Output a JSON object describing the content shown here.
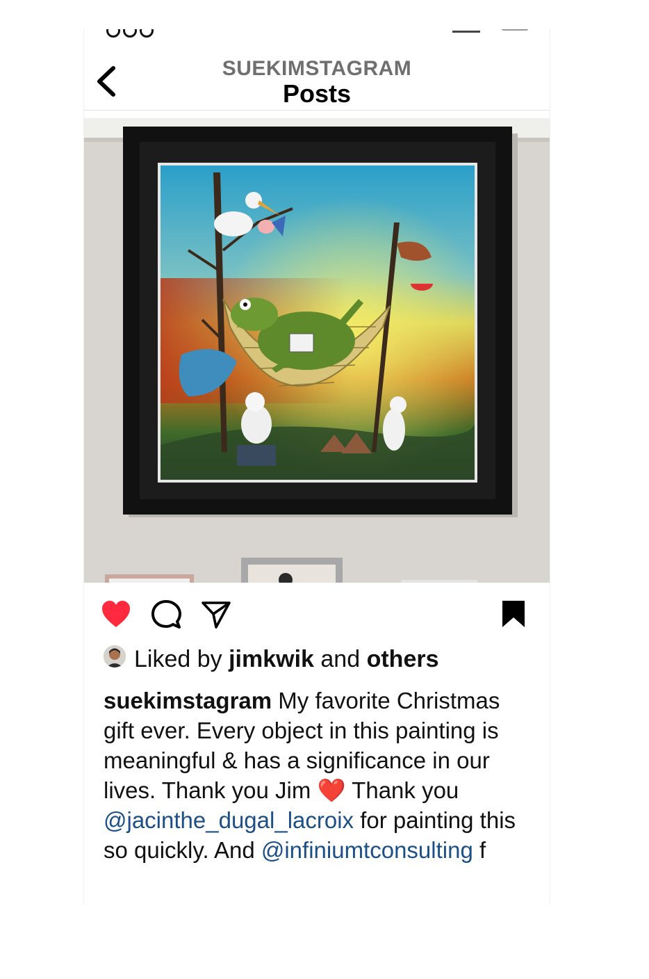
{
  "header": {
    "username": "SUEKIMSTAGRAM",
    "title": "Posts"
  },
  "post": {
    "image_alt": "Framed painting of a frog in a hammock with animals",
    "liked": true,
    "saved": true,
    "likes": {
      "prefix": "Liked by",
      "first_user": "jimkwik",
      "joiner": "and",
      "others": "others"
    },
    "caption": {
      "username": "suekimstagram",
      "text_1": " My favorite Christmas gift ever. Every object in this painting is meaningful & has a significance in our lives. Thank you Jim ",
      "emoji": "❤️",
      "text_2": " Thank you ",
      "mention_1": "@jacinthe_dugal_lacroix",
      "text_3": " for painting this so quickly. And ",
      "mention_2": "@infiniumtconsulting",
      "text_4": " f"
    }
  },
  "colors": {
    "like_red": "#ff2a3d",
    "mention_blue": "#1d4f86",
    "username_gray": "#6f6f6f"
  }
}
